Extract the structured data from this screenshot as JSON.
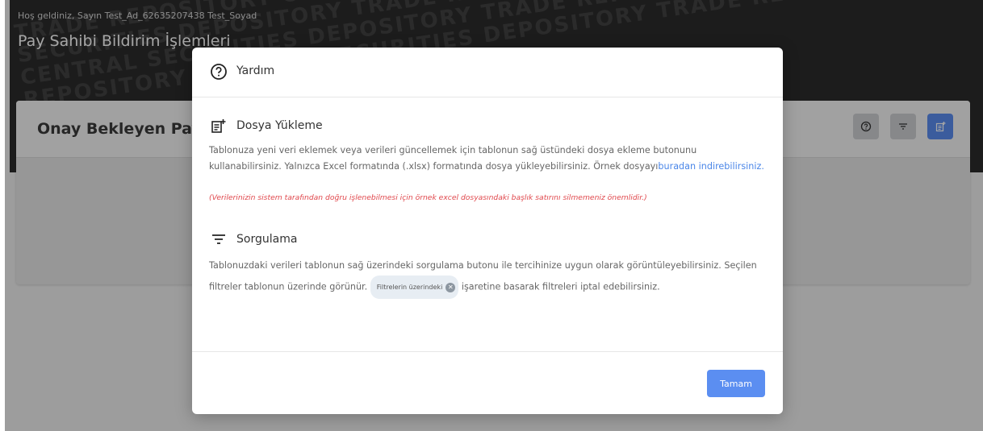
{
  "header": {
    "welcome": "Hoş geldiniz, Sayın Test_Ad_62635207438 Test_Soyad",
    "title": "Pay Sahibi Bildirim İşlemleri"
  },
  "card": {
    "title": "Onay Bekleyen Pay",
    "icons": [
      "help-icon",
      "filter-icon",
      "add-file-icon"
    ]
  },
  "modal": {
    "title": "Yardım",
    "sections": [
      {
        "title": "Dosya Yükleme",
        "text_before_link": "Tablonuza yeni veri eklemek veya verileri güncellemek için tablonun sağ üstündeki dosya ekleme butonunu kullanabilirsiniz. Yalnızca Excel formatında (.xlsx) formatında dosya yükleyebilirsiniz. Örnek dosyayı",
        "link": "buradan indirebilirsiniz.",
        "warning": "(Verilerinizin sistem tarafından doğru işlenebilmesi için örnek excel dosyasındaki başlık satırını silmemeniz önemlidir.)"
      },
      {
        "title": "Sorgulama",
        "text_before_chip": "Tablonuzdaki verileri tablonun sağ üzerindeki sorgulama butonu ile tercihinize uygun olarak görüntüleyebilirsiniz. Seçilen filtreler tablonun üzerinde görünür.",
        "chip_label": "Filtrelerin üzerindeki",
        "text_after_chip": "işaretine basarak filtreleri iptal edebilirsiniz."
      }
    ],
    "ok_label": "Tamam"
  },
  "colors": {
    "primary": "#5b8ef1",
    "warning": "#e0474c",
    "link": "#4a86e8",
    "hero_bg": "#2c2c2c"
  }
}
